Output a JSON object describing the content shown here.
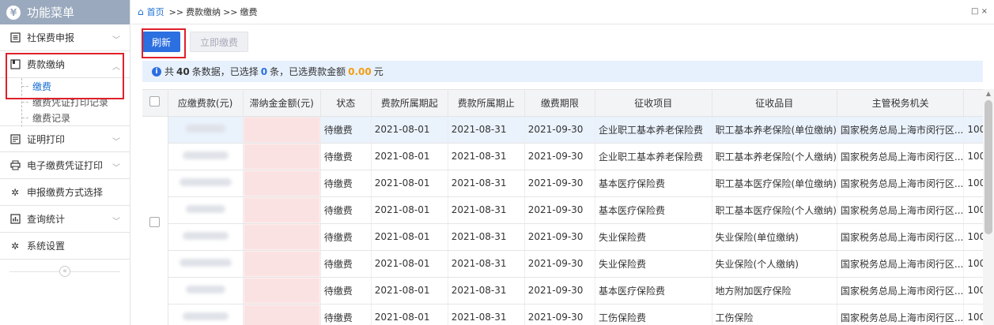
{
  "sidebar": {
    "title": "功能菜单",
    "title_icon": "¥",
    "items": [
      {
        "label": "社保费申报",
        "icon": "form-icon"
      },
      {
        "label": "费款缴纳",
        "icon": "card-icon",
        "expanded": true,
        "children": [
          "缴费",
          "缴费凭证打印记录",
          "缴费记录"
        ]
      },
      {
        "label": "证明打印",
        "icon": "doc-icon"
      },
      {
        "label": "电子缴费凭证打印",
        "icon": "print-icon"
      },
      {
        "label": "申报缴费方式选择",
        "icon": "gear-icon"
      },
      {
        "label": "查询统计",
        "icon": "chart-icon"
      },
      {
        "label": "系统设置",
        "icon": "gear-icon"
      }
    ],
    "collapse_glyph": "«"
  },
  "breadcrumb": {
    "home": "首页",
    "sep": ">>",
    "level1": "费款缴纳",
    "level2": "缴费",
    "window_controls": "□ ×"
  },
  "toolbar": {
    "refresh_label": "刷新",
    "pay_label": "立即缴费"
  },
  "info": {
    "prefix": "共",
    "count": "40",
    "mid1": "条数据，已选择",
    "selected": "0",
    "mid2": "条，已选费款金额",
    "amount": "0.00",
    "suffix": "元"
  },
  "table": {
    "headers": [
      "应缴费款(元)",
      "滞纳金金额(元)",
      "状态",
      "费款所属期起",
      "费款所属期止",
      "缴费期限",
      "征收项目",
      "征收品目",
      "主管税务机关",
      ""
    ],
    "rows": [
      {
        "status": "待缴费",
        "start": "2021-08-01",
        "end": "2021-08-31",
        "deadline": "2021-09-30",
        "item": "企业职工基本养老保险费",
        "subitem": "职工基本养老保险(单位缴纳)",
        "org": "国家税务总局上海市闵行区...",
        "extra": "100"
      },
      {
        "status": "待缴费",
        "start": "2021-08-01",
        "end": "2021-08-31",
        "deadline": "2021-09-30",
        "item": "企业职工基本养老保险费",
        "subitem": "职工基本养老保险(个人缴纳)",
        "org": "国家税务总局上海市闵行区...",
        "extra": "100"
      },
      {
        "status": "待缴费",
        "start": "2021-08-01",
        "end": "2021-08-31",
        "deadline": "2021-09-30",
        "item": "基本医疗保险费",
        "subitem": "职工基本医疗保险(单位缴纳)",
        "org": "国家税务总局上海市闵行区...",
        "extra": "100"
      },
      {
        "status": "待缴费",
        "start": "2021-08-01",
        "end": "2021-08-31",
        "deadline": "2021-09-30",
        "item": "基本医疗保险费",
        "subitem": "职工基本医疗保险(个人缴纳)",
        "org": "国家税务总局上海市闵行区...",
        "extra": "100"
      },
      {
        "status": "待缴费",
        "start": "2021-08-01",
        "end": "2021-08-31",
        "deadline": "2021-09-30",
        "item": "失业保险费",
        "subitem": "失业保险(单位缴纳)",
        "org": "国家税务总局上海市闵行区...",
        "extra": "100"
      },
      {
        "status": "待缴费",
        "start": "2021-08-01",
        "end": "2021-08-31",
        "deadline": "2021-09-30",
        "item": "失业保险费",
        "subitem": "失业保险(个人缴纳)",
        "org": "国家税务总局上海市闵行区...",
        "extra": "100"
      },
      {
        "status": "待缴费",
        "start": "2021-08-01",
        "end": "2021-08-31",
        "deadline": "2021-09-30",
        "item": "基本医疗保险费",
        "subitem": "地方附加医疗保险",
        "org": "国家税务总局上海市闵行区...",
        "extra": "100"
      },
      {
        "status": "待缴费",
        "start": "2021-08-01",
        "end": "2021-08-31",
        "deadline": "2021-09-30",
        "item": "工伤保险费",
        "subitem": "工伤保险",
        "org": "国家税务总局上海市闵行区...",
        "extra": "100"
      }
    ]
  },
  "colors": {
    "primary": "#2c6fe0",
    "highlight": "#e0202a",
    "header_bg": "#9aa9bd"
  }
}
